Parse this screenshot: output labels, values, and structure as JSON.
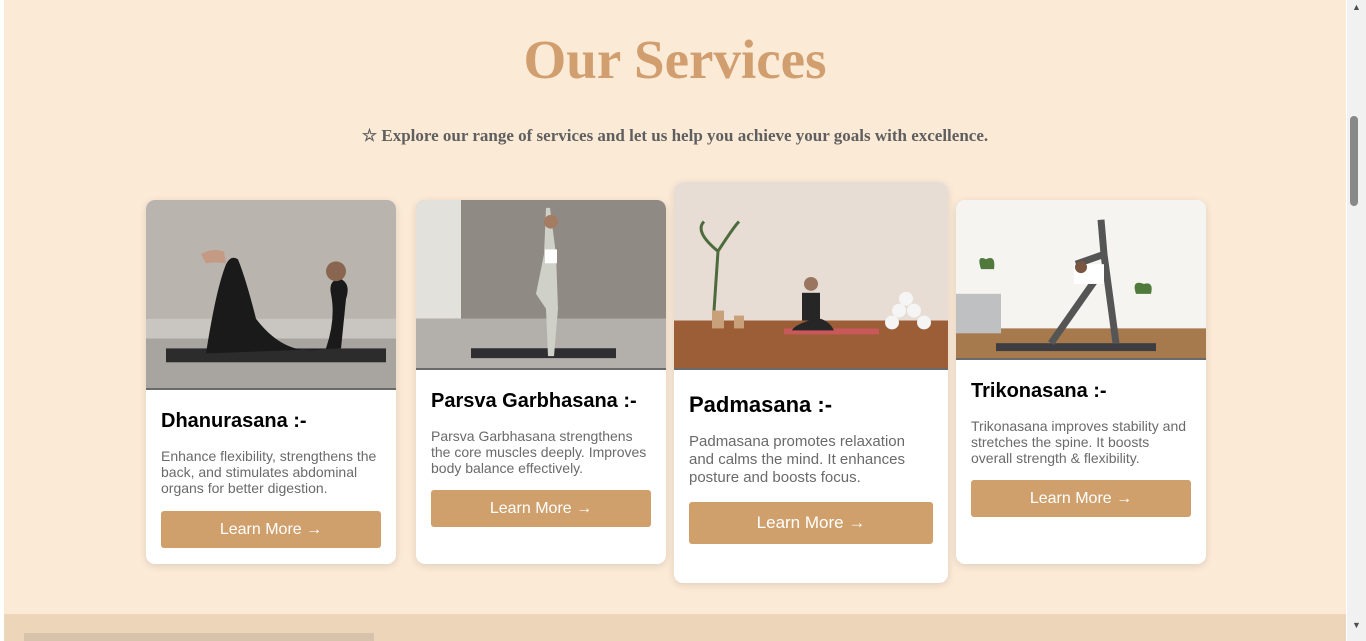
{
  "section": {
    "title": "Our Services",
    "subtitle": "☆ Explore our range of services and let us help you achieve your goals with excellence."
  },
  "cards": [
    {
      "title": "Dhanurasana :-",
      "description": "Enhance flexibility, strengthens the back, and stimulates abdominal organs for better digestion.",
      "button": "Learn More →"
    },
    {
      "title": "Parsva Garbhasana :-",
      "description": "Parsva Garbhasana strengthens the core muscles deeply. Improves body balance effectively.",
      "button": "Learn More →"
    },
    {
      "title": "Padmasana :-",
      "description": "Padmasana promotes relaxation and calms the mind. It enhances posture and boosts focus.",
      "button": "Learn More →"
    },
    {
      "title": "Trikonasana :-",
      "description": "Trikonasana improves stability and stretches the spine. It boosts overall strength & flexibility.",
      "button": "Learn More →"
    }
  ],
  "icons": {
    "scroll_up": "▲",
    "scroll_down": "▼"
  },
  "colors": {
    "background": "#fbead6",
    "accent": "#d19f6f",
    "button": "#cfa06c"
  }
}
